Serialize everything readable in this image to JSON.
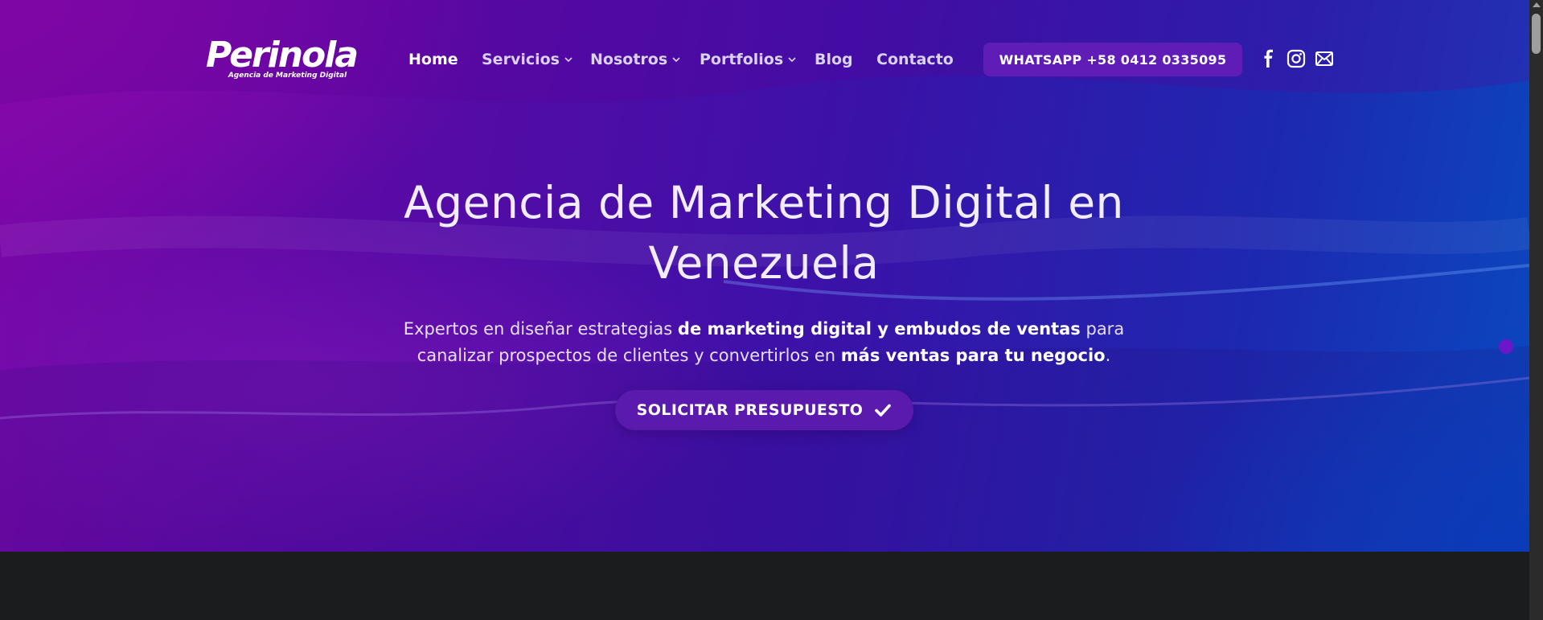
{
  "header": {
    "logo": {
      "name": "Perinola",
      "tagline": "Agencia de Marketing Digital"
    },
    "nav": [
      {
        "label": "Home",
        "dropdown": false,
        "active": true
      },
      {
        "label": "Servicios",
        "dropdown": true,
        "active": false
      },
      {
        "label": "Nosotros",
        "dropdown": true,
        "active": false
      },
      {
        "label": "Portfolios",
        "dropdown": true,
        "active": false
      },
      {
        "label": "Blog",
        "dropdown": false,
        "active": false
      },
      {
        "label": "Contacto",
        "dropdown": false,
        "active": false
      }
    ],
    "whatsapp_button": "WHATSAPP +58 0412 0335095",
    "social": [
      "facebook-icon",
      "instagram-icon",
      "email-icon"
    ]
  },
  "hero": {
    "headline_line1": "Agencia de Marketing Digital en",
    "headline_line2": "Venezuela",
    "subtitle": {
      "p1": "Expertos en diseñar estrategias ",
      "b1": "de marketing digital y embudos de ventas",
      "p2": " para",
      "p3": "canalizar prospectos de clientes y convertirlos en ",
      "b2": "más ventas para tu negocio",
      "p4": "."
    },
    "cta_label": "SOLICITAR PRESUPUESTO",
    "cta_icon": "checkmark-icon"
  },
  "colors": {
    "hero_start": "#7a07a8",
    "hero_end": "#0a49c0",
    "button": "#5f1cb7",
    "dark_section": "#1b1c1e"
  }
}
